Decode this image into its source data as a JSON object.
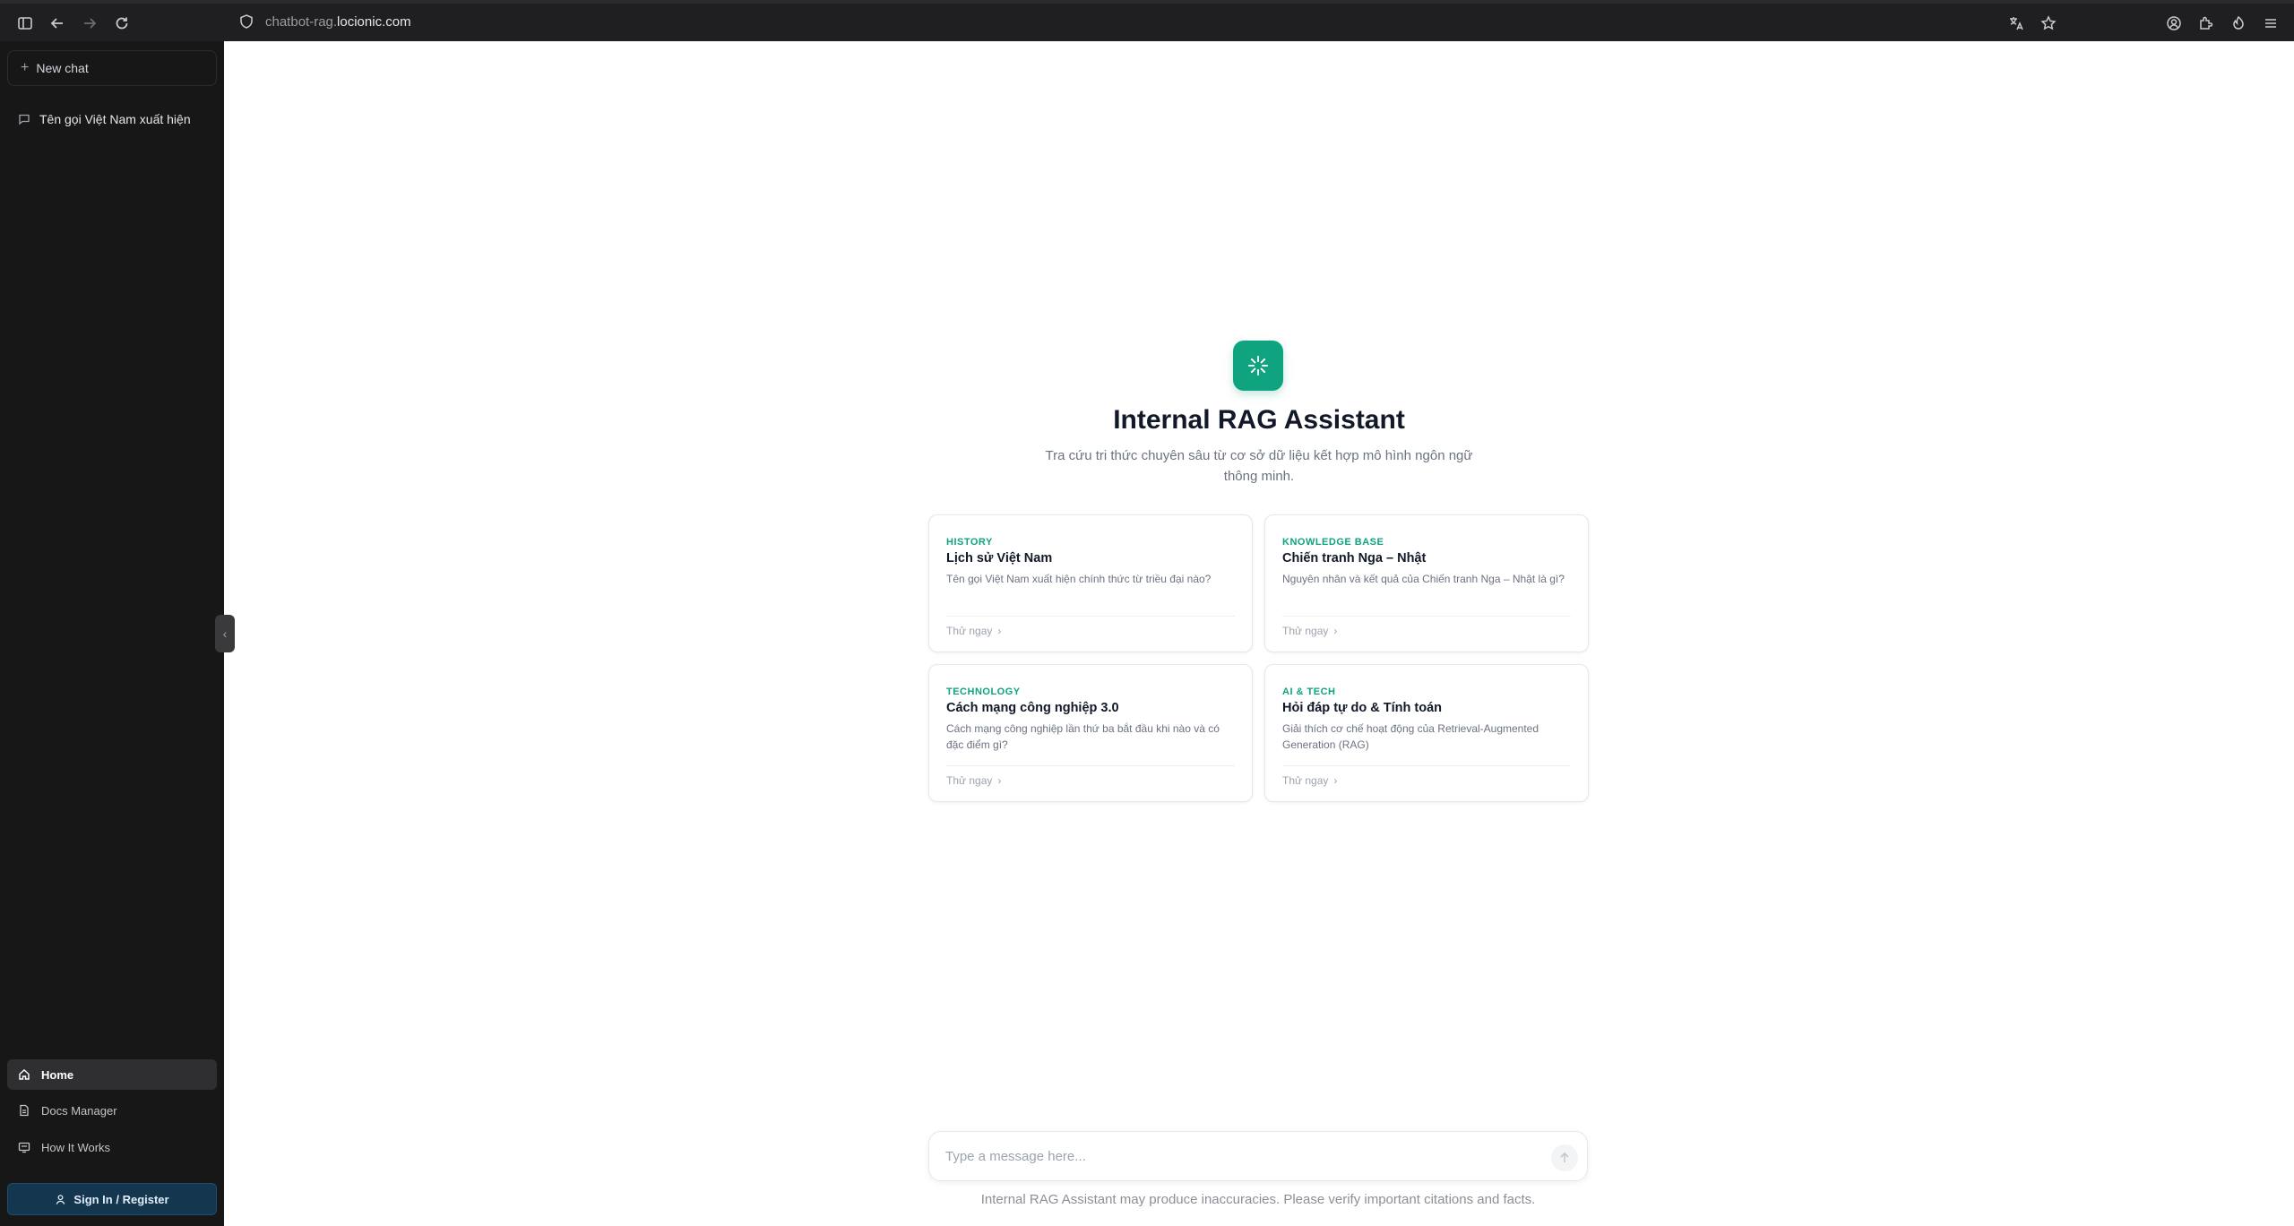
{
  "browser": {
    "url_dim": "chatbot-rag.",
    "url_main": "locionic.com"
  },
  "sidebar": {
    "new_chat_label": "New chat",
    "chats": [
      {
        "label": "Tên gọi Việt Nam xuất hiện"
      }
    ],
    "nav": [
      {
        "label": "Home",
        "icon": "home-icon",
        "active": true
      },
      {
        "label": "Docs Manager",
        "icon": "document-icon",
        "active": false
      },
      {
        "label": "How It Works",
        "icon": "info-card-icon",
        "active": false
      }
    ],
    "sign_in_label": "Sign In / Register"
  },
  "main": {
    "title": "Internal RAG Assistant",
    "subtitle": "Tra cứu tri thức chuyên sâu từ cơ sở dữ liệu kết hợp mô hình ngôn ngữ thông minh.",
    "cards": [
      {
        "category": "HISTORY",
        "title": "Lịch sử Việt Nam",
        "description": "Tên gọi Việt Nam xuất hiện chính thức từ triều đại nào?",
        "action": "Thử ngay"
      },
      {
        "category": "KNOWLEDGE BASE",
        "title": "Chiến tranh Nga – Nhật",
        "description": "Nguyên nhân và kết quả của Chiến tranh Nga – Nhật là gì?",
        "action": "Thử ngay"
      },
      {
        "category": "TECHNOLOGY",
        "title": "Cách mạng công nghiệp 3.0",
        "description": "Cách mạng công nghiệp lần thứ ba bắt đầu khi nào và có đặc điểm gì?",
        "action": "Thử ngay"
      },
      {
        "category": "AI & TECH",
        "title": "Hỏi đáp tự do & Tính toán",
        "description": "Giải thích cơ chế hoạt động của Retrieval-Augmented Generation (RAG)",
        "action": "Thử ngay"
      }
    ],
    "composer": {
      "placeholder": "Type a message here...",
      "value": ""
    },
    "disclaimer": "Internal RAG Assistant may produce inaccuracies. Please verify important citations and facts."
  },
  "colors": {
    "accent": "#10a37f",
    "sidebar_bg": "#171717",
    "sign_in_bg": "#14364f"
  }
}
